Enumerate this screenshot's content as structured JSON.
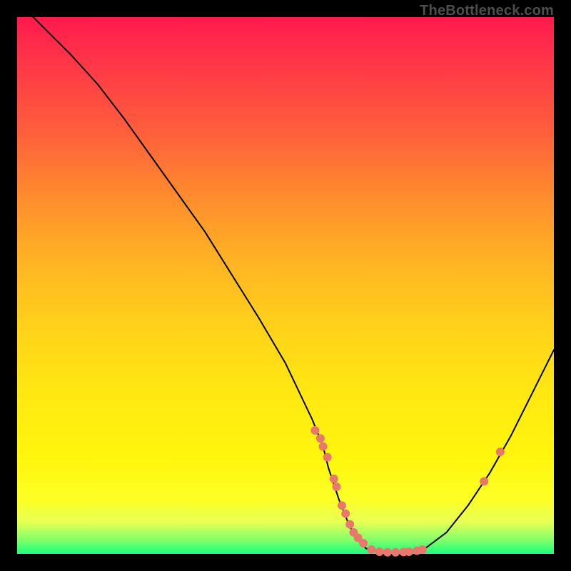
{
  "watermark": "TheBottleneck.com",
  "chart_data": {
    "type": "line",
    "title": "",
    "xlabel": "",
    "ylabel": "",
    "xlim": [
      0,
      100
    ],
    "ylim": [
      0,
      100
    ],
    "grid": false,
    "legend": false,
    "series": [
      {
        "name": "curve",
        "kind": "line",
        "x": [
          3,
          6,
          10,
          15,
          20,
          25,
          30,
          35,
          40,
          45,
          50,
          55,
          57,
          58,
          60,
          62,
          65,
          68,
          71,
          74,
          76,
          80,
          84,
          88,
          92,
          96,
          100
        ],
        "y": [
          100,
          97,
          93,
          87.5,
          81,
          74,
          67,
          60,
          52,
          44,
          35.5,
          25,
          20,
          16,
          10,
          5,
          1,
          0.4,
          0.3,
          0.4,
          1,
          4,
          9,
          15,
          22,
          30,
          38
        ]
      },
      {
        "name": "dots",
        "kind": "scatter",
        "x": [
          55.5,
          56.5,
          57,
          57.8,
          59,
          59.5,
          60.5,
          61.2,
          62,
          62.7,
          63.5,
          64.5,
          66,
          67.5,
          69,
          70.5,
          72,
          73,
          74.5,
          75.5,
          87,
          90
        ],
        "y": [
          23,
          21.5,
          20,
          18,
          14,
          12.5,
          9,
          7.5,
          5.5,
          4,
          3,
          2,
          0.8,
          0.4,
          0.3,
          0.3,
          0.35,
          0.4,
          0.6,
          0.8,
          13.5,
          19
        ]
      }
    ],
    "colors": {
      "curve": "#000000",
      "dot": "#e8786b"
    }
  }
}
